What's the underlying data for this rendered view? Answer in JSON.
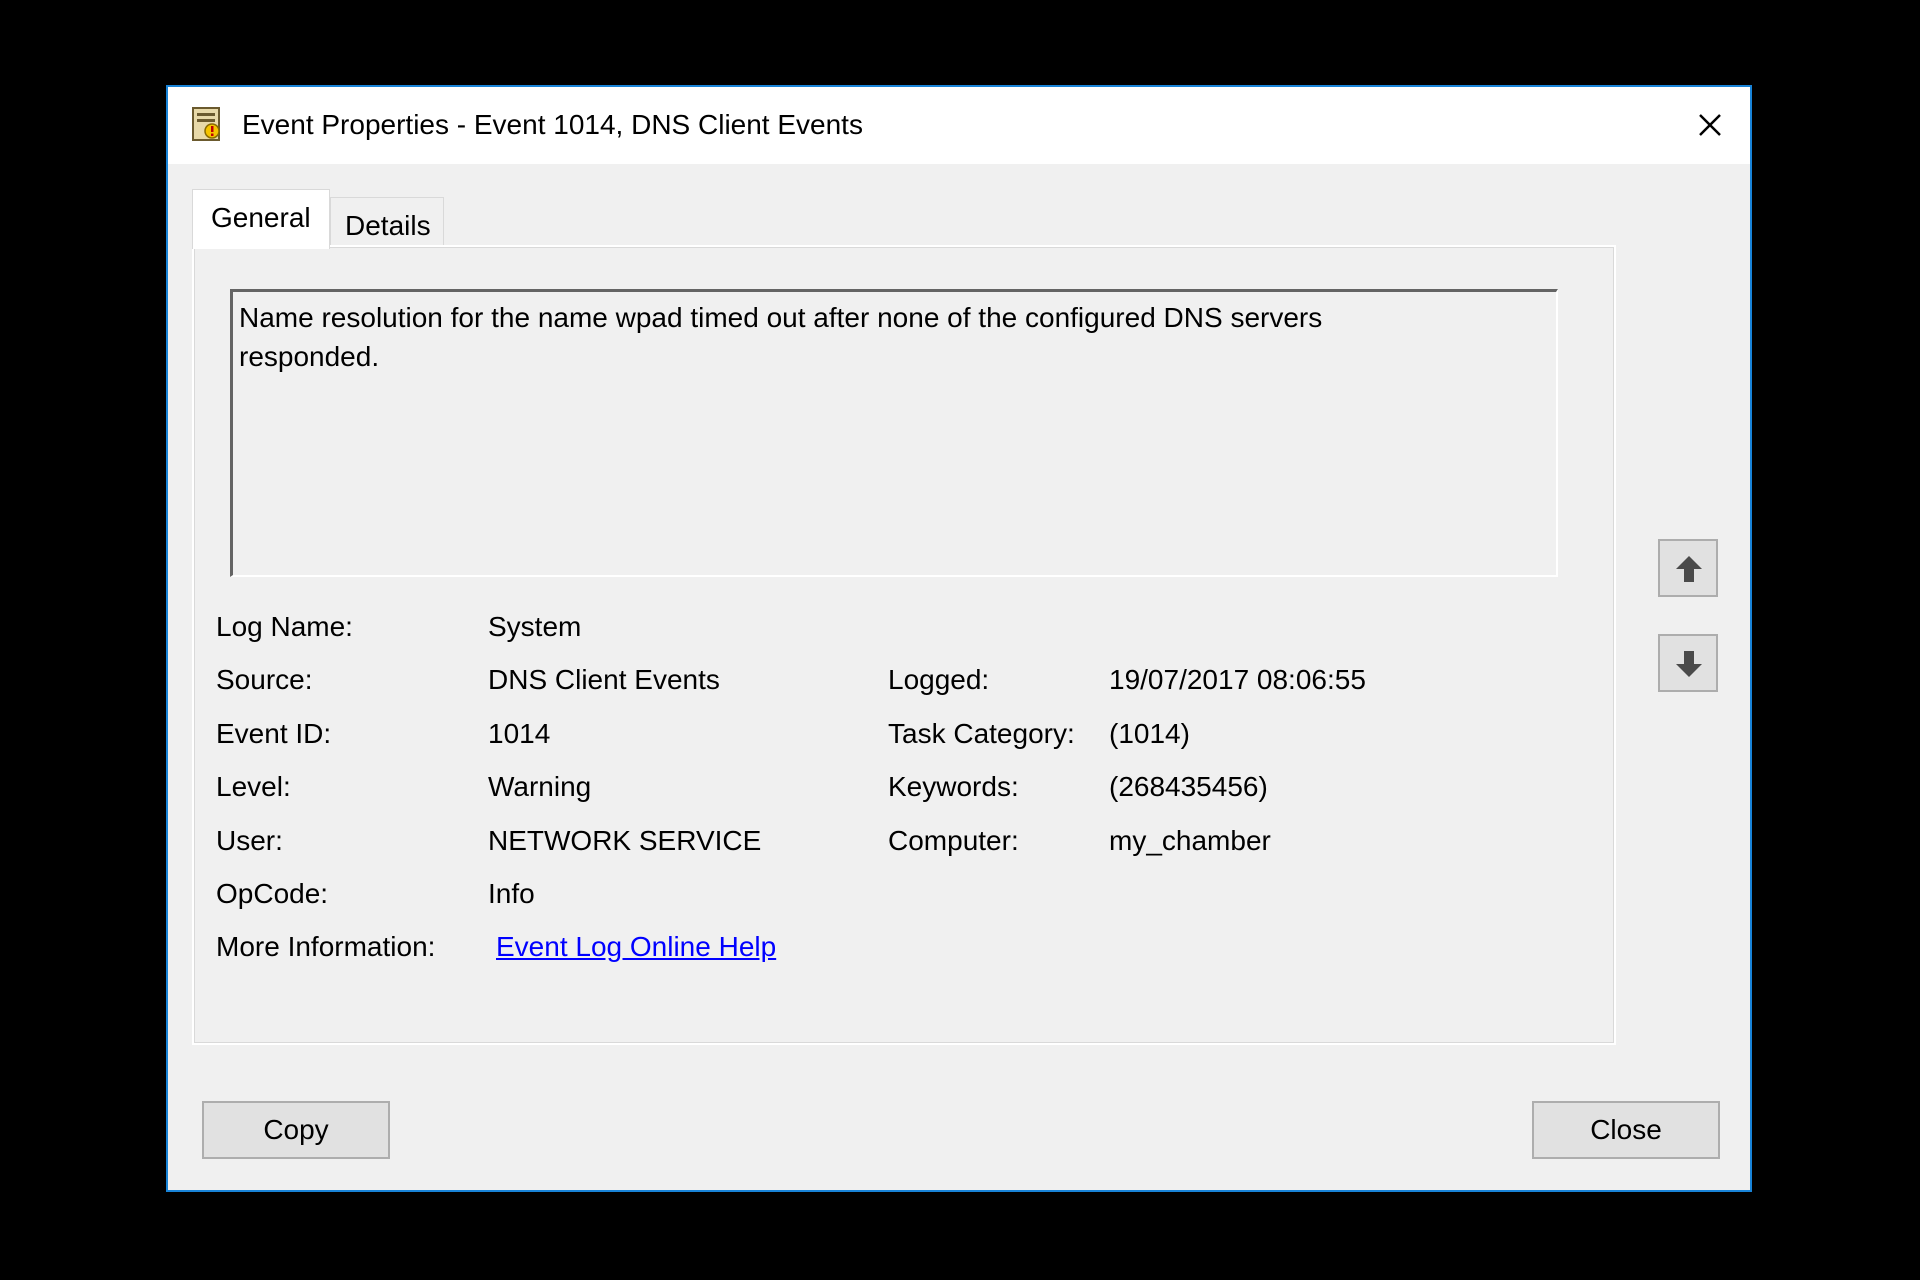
{
  "window": {
    "title": "Event Properties - Event 1014, DNS Client Events"
  },
  "tabs": [
    {
      "label": "General",
      "active": true
    },
    {
      "label": "Details",
      "active": false
    }
  ],
  "description": "Name resolution for the name wpad timed out after none of the configured DNS servers responded.",
  "fields": {
    "log_name": {
      "label": "Log Name:",
      "value": "System"
    },
    "source": {
      "label": "Source:",
      "value": "DNS Client Events"
    },
    "event_id": {
      "label": "Event ID:",
      "value": "1014"
    },
    "level": {
      "label": "Level:",
      "value": "Warning"
    },
    "user": {
      "label": "User:",
      "value": "NETWORK SERVICE"
    },
    "opcode": {
      "label": "OpCode:",
      "value": "Info"
    },
    "more_info": {
      "label": "More Information:",
      "value": "Event Log Online Help"
    },
    "logged": {
      "label": "Logged:",
      "value": "19/07/2017 08:06:55"
    },
    "task_category": {
      "label": "Task Category:",
      "value": "(1014)"
    },
    "keywords": {
      "label": "Keywords:",
      "value": "(268435456)"
    },
    "computer": {
      "label": "Computer:",
      "value": "my_chamber"
    }
  },
  "buttons": {
    "copy": "Copy",
    "close": "Close"
  },
  "icons": {
    "app": "event-viewer-icon",
    "close": "close-icon",
    "previous": "arrow-up-icon",
    "next": "arrow-down-icon"
  },
  "colors": {
    "window_border": "#1883d7",
    "link": "#0000ff",
    "dialog_bg": "#f0f0f0"
  }
}
